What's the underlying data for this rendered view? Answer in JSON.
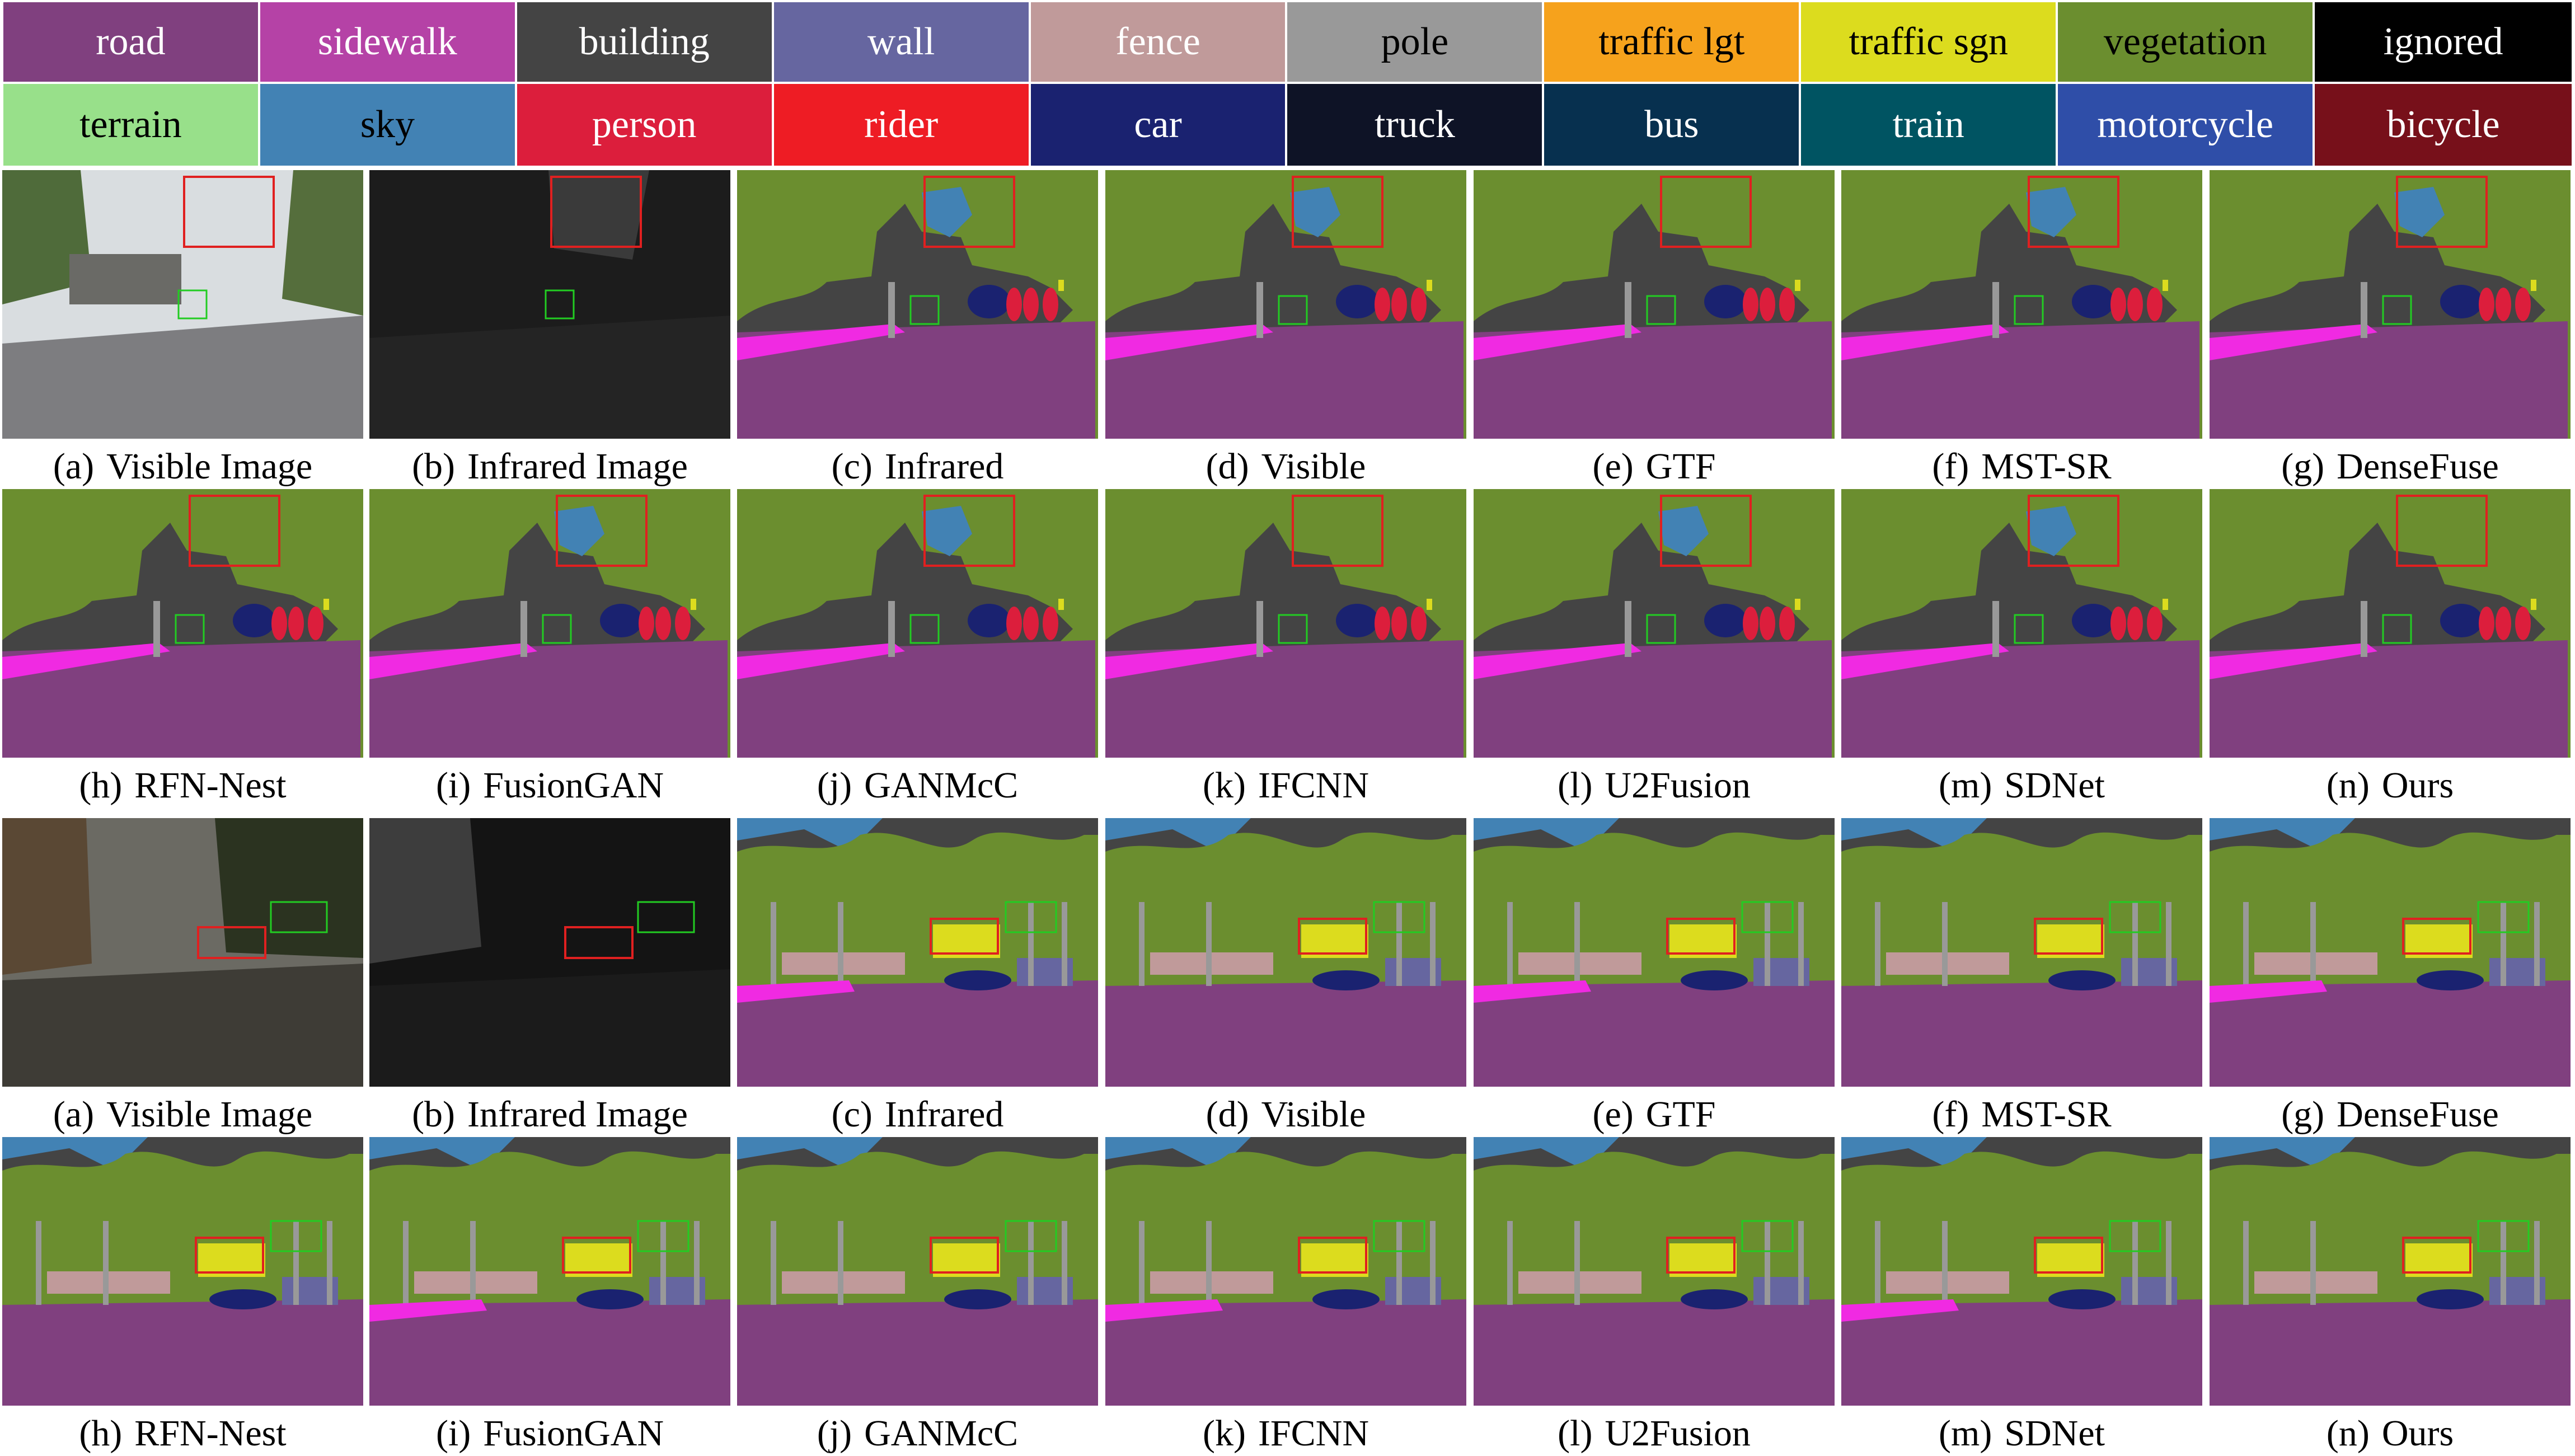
{
  "legend": [
    {
      "label": "road",
      "color": "#80407f",
      "text_color": "#ffffff"
    },
    {
      "label": "sidewalk",
      "color": "#b542a6",
      "text_color": "#ffffff"
    },
    {
      "label": "building",
      "color": "#444444",
      "text_color": "#ffffff"
    },
    {
      "label": "wall",
      "color": "#6666a0",
      "text_color": "#ffffff"
    },
    {
      "label": "fence",
      "color": "#c09a9a",
      "text_color": "#ffffff"
    },
    {
      "label": "pole",
      "color": "#999999",
      "text_color": "#000000"
    },
    {
      "label": "traffic lgt",
      "color": "#f6a21c",
      "text_color": "#000000"
    },
    {
      "label": "traffic sgn",
      "color": "#dcdc1e",
      "text_color": "#000000"
    },
    {
      "label": "vegetation",
      "color": "#6b8e2f",
      "text_color": "#000000"
    },
    {
      "label": "ignored",
      "color": "#000000",
      "text_color": "#ffffff"
    },
    {
      "label": "terrain",
      "color": "#98e08a",
      "text_color": "#000000"
    },
    {
      "label": "sky",
      "color": "#4282b4",
      "text_color": "#000000"
    },
    {
      "label": "person",
      "color": "#dc1e3c",
      "text_color": "#ffffff"
    },
    {
      "label": "rider",
      "color": "#ee1c24",
      "text_color": "#ffffff"
    },
    {
      "label": "car",
      "color": "#1a2270",
      "text_color": "#ffffff"
    },
    {
      "label": "truck",
      "color": "#0e1326",
      "text_color": "#ffffff"
    },
    {
      "label": "bus",
      "color": "#07304f",
      "text_color": "#ffffff"
    },
    {
      "label": "train",
      "color": "#005462",
      "text_color": "#ffffff"
    },
    {
      "label": "motorcycle",
      "color": "#2f4ea8",
      "text_color": "#ffffff"
    },
    {
      "label": "bicycle",
      "color": "#77101a",
      "text_color": "#ffffff"
    }
  ],
  "rows": [
    {
      "scene": 1,
      "panels": [
        {
          "label": "(a)",
          "name": "Visible Image",
          "kind": "visible"
        },
        {
          "label": "(b)",
          "name": "Infrared Image",
          "kind": "infrared"
        },
        {
          "label": "(c)",
          "name": "Infrared",
          "kind": "seg"
        },
        {
          "label": "(d)",
          "name": "Visible",
          "kind": "seg"
        },
        {
          "label": "(e)",
          "name": "GTF",
          "kind": "seg"
        },
        {
          "label": "(f)",
          "name": "MST-SR",
          "kind": "seg"
        },
        {
          "label": "(g)",
          "name": "DenseFuse",
          "kind": "seg"
        }
      ]
    },
    {
      "scene": 1,
      "panels": [
        {
          "label": "(h)",
          "name": "RFN-Nest",
          "kind": "seg"
        },
        {
          "label": "(i)",
          "name": "FusionGAN",
          "kind": "seg"
        },
        {
          "label": "(j)",
          "name": "GANMcC",
          "kind": "seg"
        },
        {
          "label": "(k)",
          "name": "IFCNN",
          "kind": "seg"
        },
        {
          "label": "(l)",
          "name": "U2Fusion",
          "kind": "seg"
        },
        {
          "label": "(m)",
          "name": "SDNet",
          "kind": "seg"
        },
        {
          "label": "(n)",
          "name": "Ours",
          "kind": "seg"
        }
      ]
    },
    {
      "scene": 2,
      "panels": [
        {
          "label": "(a)",
          "name": "Visible Image",
          "kind": "visible"
        },
        {
          "label": "(b)",
          "name": "Infrared Image",
          "kind": "infrared"
        },
        {
          "label": "(c)",
          "name": "Infrared",
          "kind": "seg"
        },
        {
          "label": "(d)",
          "name": "Visible",
          "kind": "seg"
        },
        {
          "label": "(e)",
          "name": "GTF",
          "kind": "seg"
        },
        {
          "label": "(f)",
          "name": "MST-SR",
          "kind": "seg"
        },
        {
          "label": "(g)",
          "name": "DenseFuse",
          "kind": "seg"
        }
      ]
    },
    {
      "scene": 2,
      "panels": [
        {
          "label": "(h)",
          "name": "RFN-Nest",
          "kind": "seg"
        },
        {
          "label": "(i)",
          "name": "FusionGAN",
          "kind": "seg"
        },
        {
          "label": "(j)",
          "name": "GANMcC",
          "kind": "seg"
        },
        {
          "label": "(k)",
          "name": "IFCNN",
          "kind": "seg"
        },
        {
          "label": "(l)",
          "name": "U2Fusion",
          "kind": "seg"
        },
        {
          "label": "(m)",
          "name": "SDNet",
          "kind": "seg"
        },
        {
          "label": "(n)",
          "name": "Ours",
          "kind": "seg"
        }
      ]
    }
  ],
  "highlight_colors": {
    "red_box": "#e02020",
    "green_box": "#22cc22"
  }
}
